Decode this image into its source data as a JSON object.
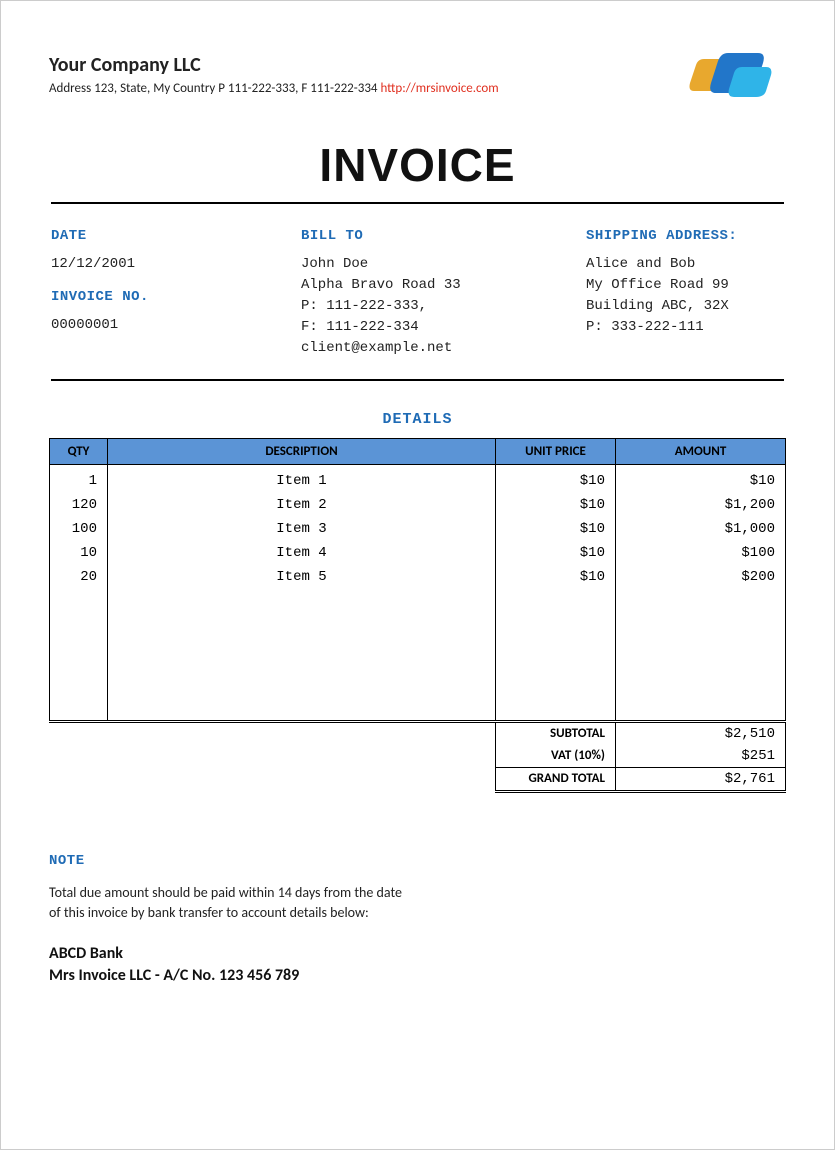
{
  "company": {
    "name": "Your Company LLC",
    "address": "Address 123, State, My Country P 111-222-333, F 111-222-334 ",
    "url": "http://mrsinvoice.com"
  },
  "title": "INVOICE",
  "info": {
    "date_label": "DATE",
    "date": "12/12/2001",
    "invoice_no_label": "INVOICE NO.",
    "invoice_no": "00000001",
    "bill_to_label": "BILL TO",
    "bill_to_lines": [
      "John Doe",
      "Alpha Bravo Road 33",
      "P: 111-222-333,",
      "F: 111-222-334",
      "client@example.net"
    ],
    "ship_label": "SHIPPING ADDRESS:",
    "ship_lines": [
      "Alice and Bob",
      "My Office Road 99",
      "Building ABC, 32X",
      "P: 333-222-111"
    ]
  },
  "details_label": "DETAILS",
  "columns": {
    "qty": "QTY",
    "desc": "DESCRIPTION",
    "unit": "UNIT PRICE",
    "amt": "AMOUNT"
  },
  "items": [
    {
      "qty": "1",
      "desc": "Item 1",
      "unit": "$10",
      "amt": "$10"
    },
    {
      "qty": "120",
      "desc": "Item 2",
      "unit": "$10",
      "amt": "$1,200"
    },
    {
      "qty": "100",
      "desc": "Item 3",
      "unit": "$10",
      "amt": "$1,000"
    },
    {
      "qty": "10",
      "desc": "Item 4",
      "unit": "$10",
      "amt": "$100"
    },
    {
      "qty": "20",
      "desc": "Item 5",
      "unit": "$10",
      "amt": "$200"
    }
  ],
  "totals": {
    "subtotal_label": "SUBTOTAL",
    "subtotal": "$2,510",
    "vat_label": "VAT (10%)",
    "vat": "$251",
    "grand_label": "GRAND TOTAL",
    "grand": "$2,761"
  },
  "note": {
    "label": "NOTE",
    "text": "Total due amount should be paid within 14 days from the date of this invoice by bank transfer to account details below:",
    "bank": "ABCD Bank",
    "account": "Mrs Invoice LLC - A/C No. 123 456 789"
  }
}
